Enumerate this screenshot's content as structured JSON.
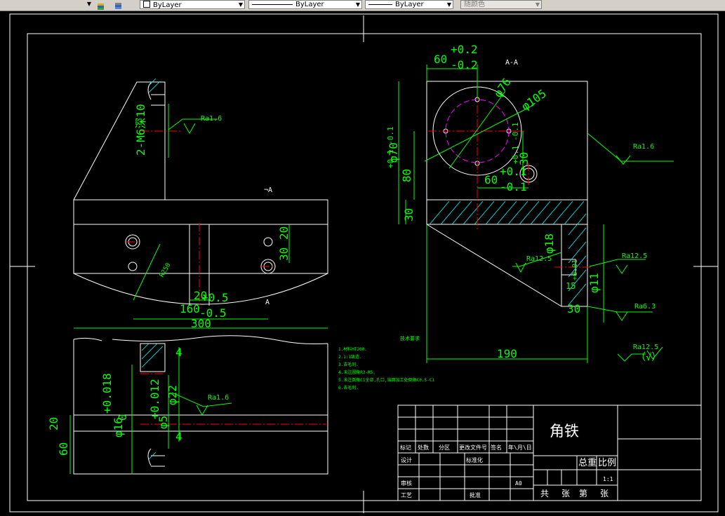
{
  "toolbar": {
    "layer_dropdown": "▼",
    "color_control": "ByLayer",
    "linetype_control": "ByLayer",
    "lineweight_control": "ByLayer",
    "plotstyle_control": "随颜色"
  },
  "drawing": {
    "colors": {
      "green": "#00ff00",
      "white": "#ffffff",
      "red": "#ff0000",
      "cyan": "#00ffff",
      "magenta": "#ff00ff"
    },
    "left_view": {
      "section_mark_top": "A",
      "section_mark_bottom": "A",
      "dim_2m6": "2-M6深10",
      "rough_top": "Ra1.6",
      "dim_r250": "R250",
      "dim_20": "20",
      "dim_160_main": "160",
      "dim_160_tol_up": "+0.5",
      "dim_160_tol_dn": "-0.5",
      "dim_300": "300",
      "dim_30": "30",
      "dim_20b": "20",
      "dim_4_top": "4",
      "dim_4_bottom": "4",
      "dim_phi16": "φ16",
      "dim_phi16_tol_up": "+0.018",
      "dim_phi16_tol_dn": "0",
      "dim_phi22": "φ22",
      "dim_phi5": "φ5",
      "dim_phi5_tol": "+0.012",
      "dim_20c": "20",
      "dim_60": "60",
      "rough_bottom": "Ra1.6"
    },
    "section_view": {
      "title": "A-A",
      "dim_60_main": "60",
      "dim_60_tol_up": "+0.2",
      "dim_60_tol_dn": "-0.2",
      "dim_phi76": "φ76",
      "dim_phi105": "φ105",
      "dim_80": "80",
      "dim_80_tol": "+0.1 -0.1",
      "dim_phi70": "φ70",
      "dim_30": "30",
      "dim_60b_main": "60",
      "dim_60b_tol_up": "+0.1",
      "dim_60b_tol_dn": "-0.1",
      "dim_30b": "30",
      "dim_30b_tol": "+0.1 -0.1",
      "rough_right": "Ra1.6",
      "dim_phi18": "φ18",
      "rough_mid": "Ra12.5",
      "rough_r1": "Ra12.5",
      "dim_15": "15",
      "dim_15_tol": "+0.01",
      "dim_phi11": "φ11",
      "dim_30c": "30",
      "rough_r2": "Ra6.3",
      "dim_190": "190",
      "rough_general": "Ra12.5",
      "rough_general_sym": "（√）"
    },
    "notes": {
      "heading": "技术要求",
      "lines": [
        "1.材料HT200.",
        "2.1:1铸造.",
        "3.去毛刺.",
        "4.未注圆角R3-R5.",
        "5.未注倒角C1全部,孔口,端面加工处倒角C0.5-C1",
        "6.去毛刺."
      ]
    },
    "title_block": {
      "part_name": "角铁",
      "h_mark": "标记",
      "h_count": "处数",
      "h_zone": "分区",
      "h_doc": "更改文件号",
      "h_sign": "签名",
      "h_date": "年\\月\\日",
      "design": "设计",
      "standard": "标准化",
      "review": "审核",
      "process": "工艺",
      "approve": "批准",
      "total_weight": "总重",
      "scale_label": "比例",
      "scale_value": "1:1",
      "sheet_size": "A0",
      "gong": "共",
      "zhang1": "张",
      "di": "第",
      "zhang2": "张"
    }
  }
}
